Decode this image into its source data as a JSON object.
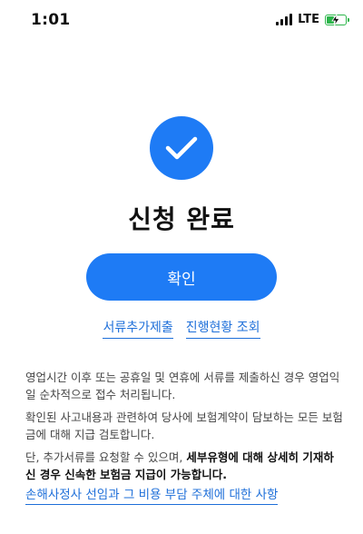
{
  "status_bar": {
    "time": "1:01",
    "network": "LTE",
    "battery_state": "charging",
    "battery_color": "#2bb54a"
  },
  "hero": {
    "icon": "check-icon",
    "accent_color": "#1e7bf5"
  },
  "title": "신청 완료",
  "confirm_button": "확인",
  "links": {
    "add_documents": "서류추가제출",
    "check_status": "진행현황 조회"
  },
  "notice": {
    "p1": "영업시간 이후 또는 공휴일 및 연휴에 서류를 제출하신 경우 영업익일 순차적으로 접수 처리됩니다.",
    "p2": "확인된 사고내용과 관련하여 당사에 보험계약이 담보하는 모든 보험금에 대해 지급 검토합니다.",
    "p3_prefix": "단, 추가서류를 요청할 수 있으며, ",
    "p3_bold": "세부유형에 대해 상세히 기재하신 경우 신속한 보험금 지급이 가능합니다."
  },
  "bottom_link": "손해사정사 선임과 그 비용 부담 주체에 대한 사항"
}
